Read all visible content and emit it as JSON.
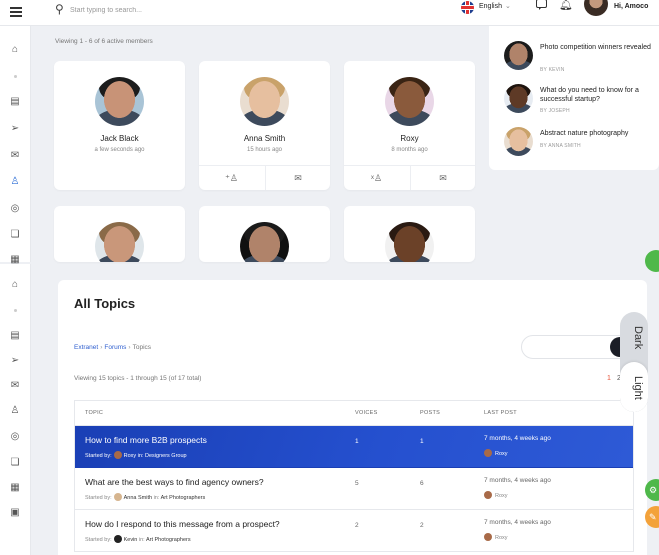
{
  "header": {
    "search_placeholder": "Start typing to search...",
    "language": "English",
    "greeting": "Hi, Amoco"
  },
  "members": {
    "viewing": "Viewing 1 - 6 of 6 active members",
    "cards": [
      {
        "name": "Jack Black",
        "time": "a few seconds ago",
        "avatar_bg": "#a9c4d6",
        "skin": "#c89377",
        "hair": "#1c1c1c"
      },
      {
        "name": "Anna Smith",
        "time": "15 hours ago",
        "avatar_bg": "#e9ddd0",
        "skin": "#e6bf9f",
        "hair": "#c9a26a"
      },
      {
        "name": "Roxy",
        "time": "8 months ago",
        "avatar_bg": "#e9d7e7",
        "skin": "#8a5a3c",
        "hair": "#3a2414"
      },
      {
        "name": "",
        "time": "",
        "avatar_bg": "#dfe6ea",
        "skin": "#c9977a",
        "hair": "#8a6a48"
      },
      {
        "name": "",
        "time": "",
        "avatar_bg": "#101010",
        "skin": "#b0836a",
        "hair": "#1a1a1a"
      },
      {
        "name": "",
        "time": "",
        "avatar_bg": "#f1f1f1",
        "skin": "#6b4128",
        "hair": "#2a1a12"
      }
    ]
  },
  "widget": {
    "items": [
      {
        "title": "Photo competition winners revealed",
        "by": "BY KEVIN",
        "avatar_bg": "#1d1d1d"
      },
      {
        "title": "What do you need to know for a successful startup?",
        "by": "BY JOSEPH",
        "avatar_bg": "#e7ecf2"
      },
      {
        "title": "Abstract nature photography",
        "by": "BY ANNA SMITH",
        "avatar_bg": "#e9ddd0"
      }
    ]
  },
  "topics": {
    "title": "All Topics",
    "breadcrumb": {
      "home": "Extranet",
      "forums": "Forums",
      "current": "Topics"
    },
    "viewing": "Viewing 15 topics - 1 through 15 (of 17 total)",
    "pagination": {
      "page1": "1",
      "page2": "2"
    },
    "columns": {
      "topic": "TOPIC",
      "voices": "VOICES",
      "posts": "POSTS",
      "last_post": "LAST POST"
    },
    "rows": [
      {
        "title": "How to find more B2B prospects",
        "started_by": "Started by:",
        "author": "Roxy",
        "in_label": "in:",
        "forum": "Designers Group",
        "voices": "1",
        "posts": "1",
        "last_post": "7 months, 4 weeks ago",
        "last_by": "Roxy"
      },
      {
        "title": "What are the best ways to find agency owners?",
        "started_by": "Started by:",
        "author": "Anna Smith",
        "in_label": "in:",
        "forum": "Art Photographers",
        "voices": "5",
        "posts": "6",
        "last_post": "7 months, 4 weeks ago",
        "last_by": "Roxy"
      },
      {
        "title": "How do I respond to this message from a prospect?",
        "started_by": "Started by:",
        "author": "Kevin",
        "in_label": "in:",
        "forum": "Art Photographers",
        "voices": "2",
        "posts": "2",
        "last_post": "7 months, 4 weeks ago",
        "last_by": "Roxy"
      }
    ]
  },
  "mode": {
    "dark": "Dark",
    "light": "Light"
  },
  "colors": {
    "accent": "#2f5fcf",
    "highlight": "#1a3fb5",
    "pagination_active": "#e8553a"
  }
}
